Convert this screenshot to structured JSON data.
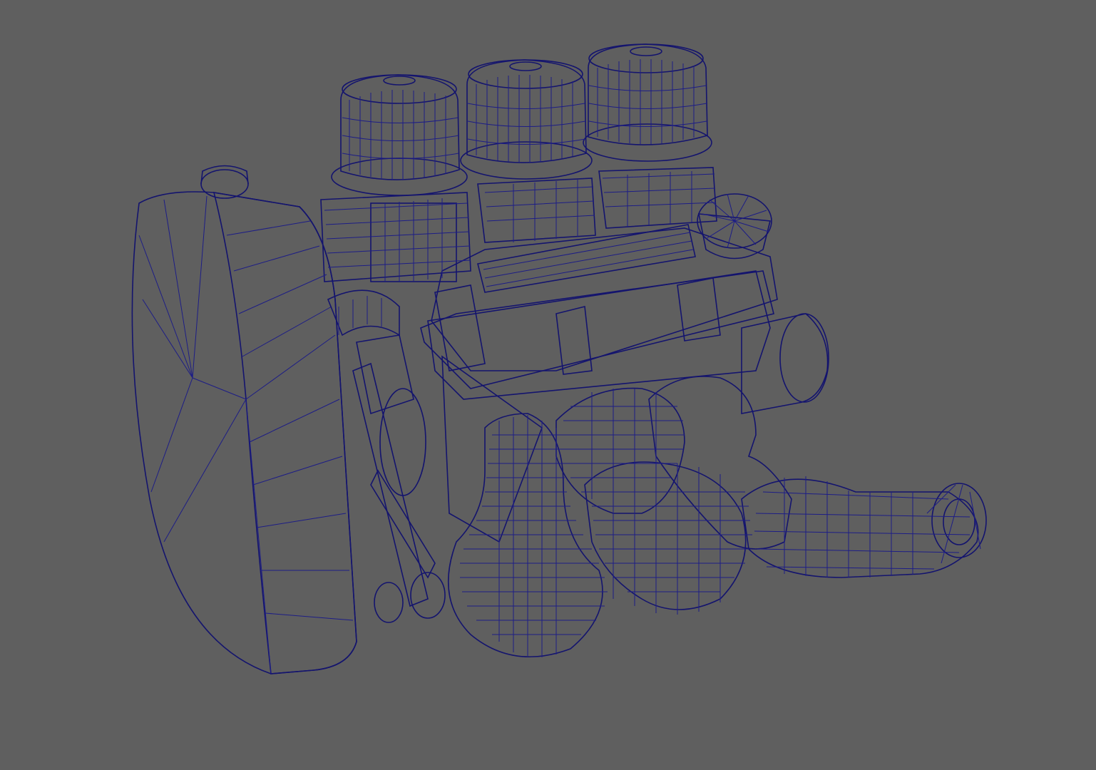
{
  "app": {
    "view": "3D viewport",
    "background_color": "#5f5f5f"
  },
  "viewport": {
    "display_mode": "wireframe-on-shaded",
    "subject": "engine-model",
    "shaded_color": "#9e9e9e",
    "wireframe_color": "#1d1d86"
  },
  "model_parts": [
    {
      "name": "air-filter-left",
      "icon": "cylinder-icon"
    },
    {
      "name": "air-filter-middle",
      "icon": "cylinder-icon"
    },
    {
      "name": "air-filter-right",
      "icon": "cylinder-icon"
    },
    {
      "name": "radiator-tank",
      "icon": "tank-icon"
    },
    {
      "name": "valve-cover",
      "icon": "box-icon"
    },
    {
      "name": "exhaust-manifold",
      "icon": "pipe-icon"
    },
    {
      "name": "exhaust-outlet",
      "icon": "pipe-icon"
    },
    {
      "name": "oil-cap",
      "icon": "cap-icon"
    }
  ]
}
